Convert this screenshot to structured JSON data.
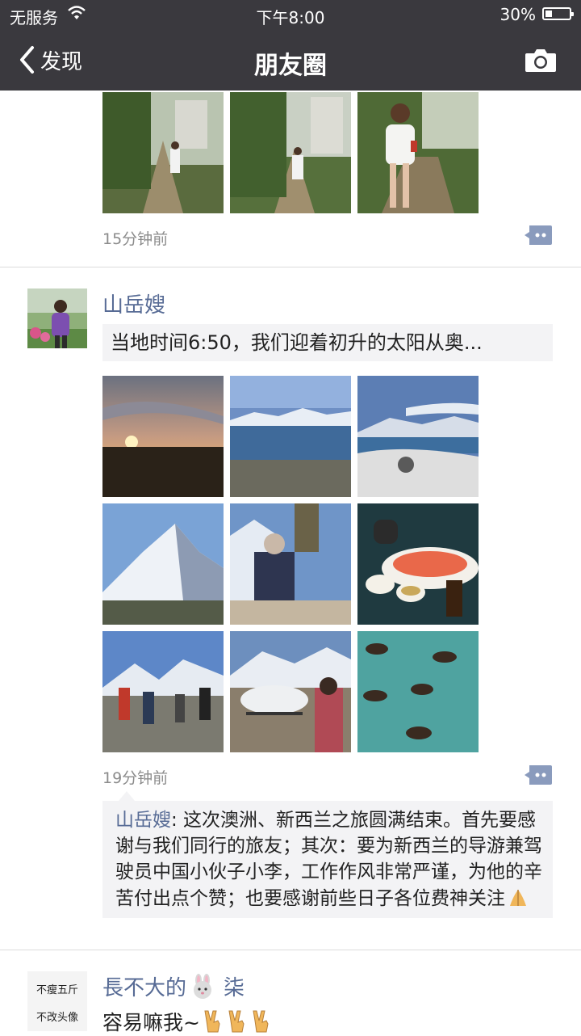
{
  "status_bar": {
    "carrier": "无服务",
    "time": "下午8:00",
    "battery": "30%",
    "battery_level": 0.3
  },
  "nav": {
    "back_label": "发现",
    "title": "朋友圈"
  },
  "post1": {
    "time": "15分钟前"
  },
  "post2": {
    "username": "山岳嫂",
    "shared_text": "当地时间6:50，我们迎着初升的太阳从奥...",
    "time": "19分钟前",
    "comment": {
      "author": "山岳嫂",
      "text": ": 这次澳洲、新西兰之旅圆满结束。首先要感谢与我们同行的旅友；其次：要为新西兰的导游兼驾驶员中国小伙子小李，工作作风非常严谨，为他的辛苦付出点个赞；也要感谢前些日子各位费神关注"
    }
  },
  "post3": {
    "avatar_line1": "不瘦五斤",
    "avatar_line2": "不改头像",
    "username_a": "長不大的",
    "username_b": "柒",
    "text": "容易嘛我~"
  }
}
